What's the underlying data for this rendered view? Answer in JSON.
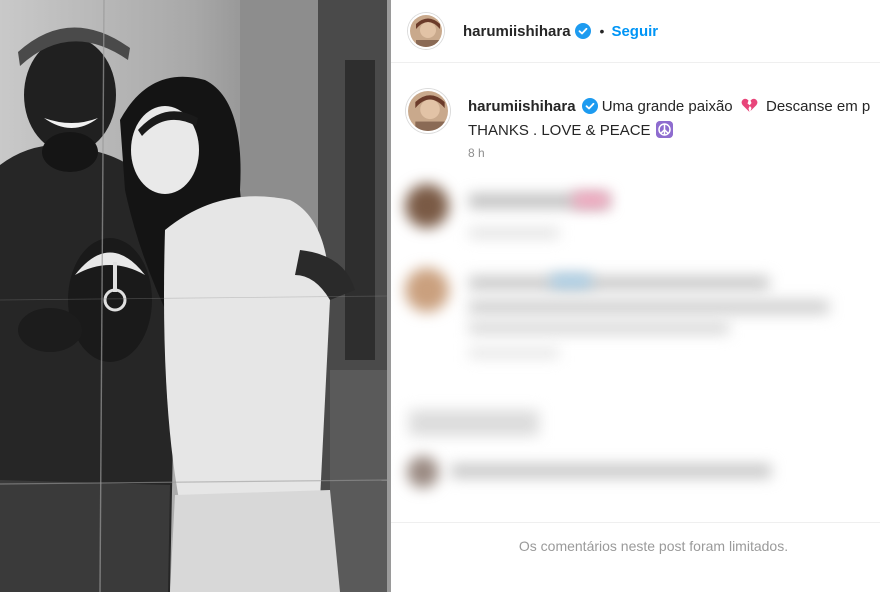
{
  "post": {
    "username": "harumiishihara",
    "verified": true,
    "separator": "•",
    "follow_label": "Seguir",
    "caption": {
      "text_line1": "Uma grande paixão",
      "text_line1_after_heart": "Descanse em p",
      "text_line2": "THANKS . LOVE & PEACE",
      "heart_emoji_icon": "broken-heart-icon",
      "peace_emoji_icon": "peace-symbol-icon"
    },
    "time_ago": "8 h",
    "comments_limited_notice": "Os comentários neste post foram limitados."
  },
  "colors": {
    "accent_follow": "#0095f6",
    "verified_badge": "#1d9bf0",
    "muted_text": "#8e8e8e",
    "peace_emoji_bg": "#8e6ccf",
    "heart_emoji": "#e8457a"
  }
}
